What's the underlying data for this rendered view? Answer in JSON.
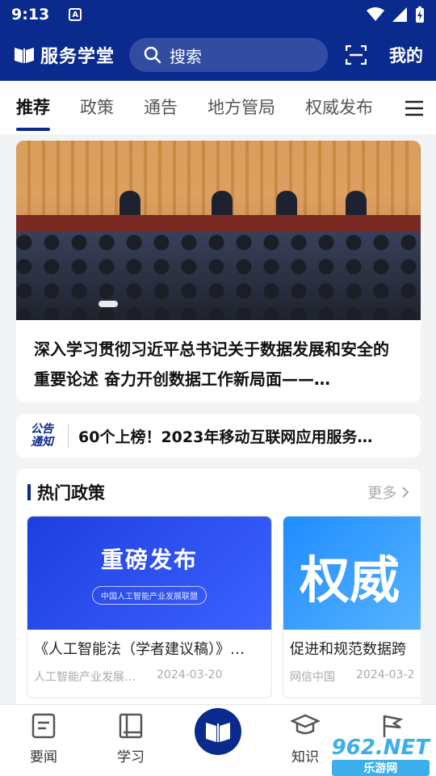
{
  "status_bar": {
    "time": "9:13",
    "notif_icon": "A"
  },
  "header": {
    "app_name": "服务学堂",
    "search_placeholder": "搜索",
    "mine_label": "我的"
  },
  "tabs": [
    {
      "label": "推荐",
      "active": true
    },
    {
      "label": "政策"
    },
    {
      "label": "通告"
    },
    {
      "label": "地方管局"
    },
    {
      "label": "权威发布"
    }
  ],
  "hero": {
    "title": "深入学习贯彻习近平总书记关于数据发展和安全的重要论述 奋力开创数据工作新局面——…"
  },
  "notice": {
    "badge_line1": "公告",
    "badge_line2": "通知",
    "text": "60个上榜！2023年移动互联网应用服务…"
  },
  "hot_policy": {
    "title": "热门政策",
    "more": "更多",
    "cards": [
      {
        "image_title": "重磅发布",
        "image_subtitle": "中国人工智能产业发展联盟",
        "title": "《人工智能法（学者建议稿）》…",
        "source": "人工智能产业发展…",
        "date": "2024-03-20"
      },
      {
        "image_title": "权威",
        "title": "促进和规范数据跨",
        "source": "网信中国",
        "date": "2024-03-2"
      }
    ]
  },
  "bottom_nav": [
    {
      "label": "要闻",
      "icon": "news-icon"
    },
    {
      "label": "学习",
      "icon": "book-icon"
    },
    {
      "label": "",
      "icon": "app-logo-icon"
    },
    {
      "label": "知识",
      "icon": "mortarboard-icon"
    },
    {
      "label": "",
      "icon": "flag-icon"
    }
  ],
  "watermark": {
    "line1": "962.NET",
    "line2": "乐游网"
  },
  "colors": {
    "brand": "#0a2a8e",
    "background": "#f2f3f5"
  }
}
